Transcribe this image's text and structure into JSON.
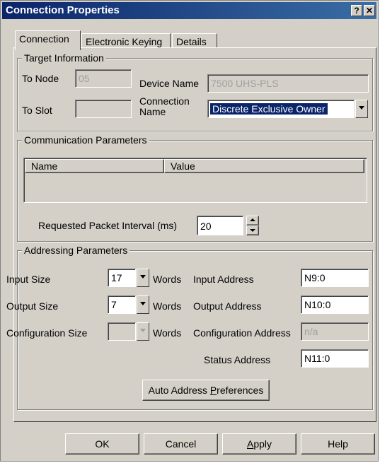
{
  "window": {
    "title": "Connection Properties",
    "help_glyph": "?",
    "close_glyph": "✕"
  },
  "tabs": [
    {
      "label": "Connection"
    },
    {
      "label": "Electronic Keying"
    },
    {
      "label": "Details"
    }
  ],
  "target_information": {
    "legend": "Target Information",
    "to_node_label": "To Node",
    "to_node_value": "05",
    "device_name_label": "Device Name",
    "device_name_value": "7500 UHS-PLS",
    "to_slot_label": "To Slot",
    "to_slot_value": "",
    "connection_name_label_1": "Connection",
    "connection_name_label_2": "Name",
    "connection_name_value": "Discrete Exclusive Owner"
  },
  "communication_parameters": {
    "legend": "Communication Parameters",
    "columns": [
      "Name",
      "Value"
    ],
    "rows": [],
    "rpi_label": "Requested Packet Interval (ms)",
    "rpi_value": "20"
  },
  "addressing_parameters": {
    "legend": "Addressing Parameters",
    "input_size_label": "Input Size",
    "input_size_value": "17",
    "output_size_label": "Output Size",
    "output_size_value": "7",
    "configuration_size_label": "Configuration Size",
    "configuration_size_value": "",
    "words_label": "Words",
    "input_address_label": "Input Address",
    "input_address_value": "N9:0",
    "output_address_label": "Output Address",
    "output_address_value": "N10:0",
    "configuration_address_label": "Configuration Address",
    "configuration_address_value": "n/a",
    "status_address_label": "Status Address",
    "status_address_value": "N11:0",
    "auto_address_button_pre": "Auto Address ",
    "auto_address_button_key": "P",
    "auto_address_button_post": "references"
  },
  "footer": {
    "ok": "OK",
    "cancel": "Cancel",
    "apply_key": "A",
    "apply_rest": "pply",
    "help": "Help"
  }
}
